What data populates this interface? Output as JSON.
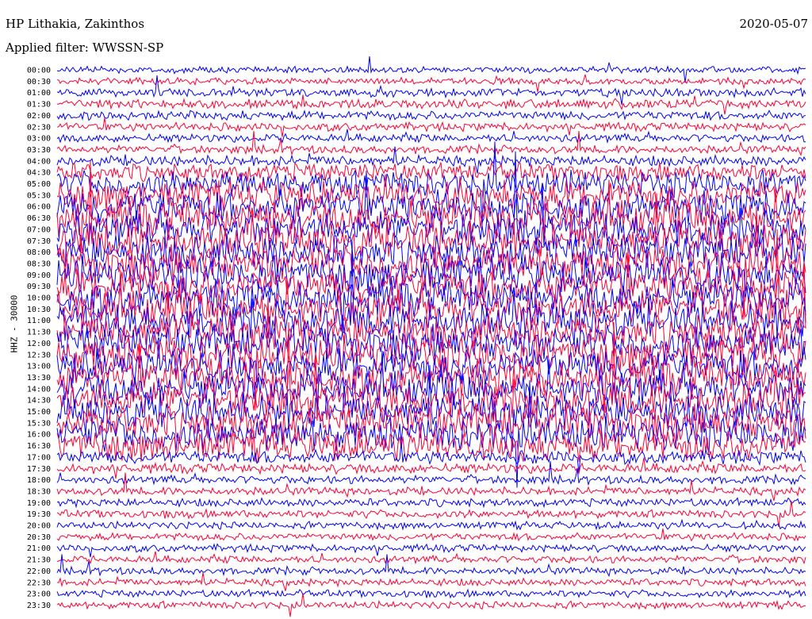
{
  "header": {
    "station": "HP Lithakia, Zakinthos",
    "filter": "Applied filter: WWSSN-SP",
    "date": "2020-05-07"
  },
  "colors": {
    "blue_trace": "#0000ff",
    "red_trace": "#ff0033",
    "background": "#ffffff",
    "text": "#000000"
  },
  "chart_data": {
    "type": "line",
    "title": "HP Lithakia, Zakinthos",
    "subtitle": "Applied filter: WWSSN-SP",
    "ylabel": "HHZ - 30000",
    "xlabel": "",
    "grid": false,
    "legend": "none",
    "trace_colors_alternate": [
      "blue",
      "red"
    ],
    "y_ticks": [
      "00:00",
      "00:30",
      "01:00",
      "01:30",
      "02:00",
      "02:30",
      "03:00",
      "03:30",
      "04:00",
      "04:30",
      "05:00",
      "05:30",
      "06:00",
      "06:30",
      "07:00",
      "07:30",
      "08:00",
      "08:30",
      "09:00",
      "09:30",
      "10:00",
      "10:30",
      "11:00",
      "11:30",
      "12:00",
      "12:30",
      "13:00",
      "13:30",
      "14:00",
      "14:30",
      "15:00",
      "15:30",
      "16:00",
      "16:30",
      "17:00",
      "17:30",
      "18:00",
      "18:30",
      "19:00",
      "19:30",
      "20:00",
      "20:30",
      "21:00",
      "21:30",
      "22:00",
      "22:30",
      "23:00",
      "23:30"
    ],
    "relative_amplitude": [
      0.8,
      0.8,
      1.0,
      1.1,
      1.1,
      1.0,
      1.0,
      1.0,
      1.3,
      2.2,
      3.2,
      3.6,
      3.9,
      4.2,
      4.2,
      4.3,
      4.3,
      4.3,
      4.3,
      4.2,
      4.3,
      4.3,
      4.3,
      4.3,
      4.3,
      4.3,
      4.3,
      4.3,
      4.2,
      4.2,
      4.2,
      4.3,
      4.1,
      3.8,
      1.6,
      1.2,
      1.0,
      1.0,
      1.0,
      1.0,
      0.9,
      0.9,
      0.9,
      0.9,
      0.9,
      0.9,
      0.9,
      0.9
    ]
  }
}
